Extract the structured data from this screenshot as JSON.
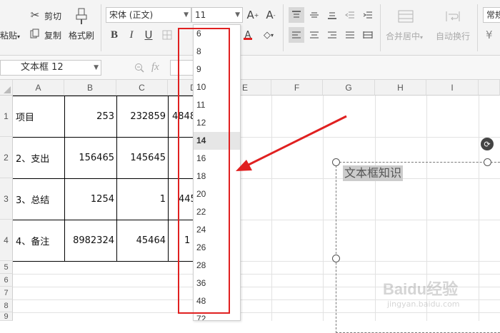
{
  "ribbon": {
    "cut": "剪切",
    "paste": "粘贴",
    "copy": "复制",
    "format_painter": "格式刷",
    "font_name": "宋体 (正文)",
    "font_size": "11",
    "bold": "B",
    "italic": "I",
    "underline": "U",
    "merge_center": "合并居中",
    "wrap_text": "自动换行",
    "number_format": "常规",
    "currency": "¥"
  },
  "formula_bar": {
    "name_box": "文本框 12",
    "fx": "fx"
  },
  "columns": [
    "A",
    "B",
    "C",
    "D",
    "E",
    "F",
    "G",
    "H",
    "I"
  ],
  "rows": [
    "1",
    "2",
    "3",
    "4",
    "5",
    "6",
    "7",
    "8",
    "9"
  ],
  "table": [
    {
      "a": "项目",
      "b": "253",
      "c": "232859",
      "d": "4848"
    },
    {
      "a": "2、支出",
      "b": "156465",
      "c": "145645",
      "d": ""
    },
    {
      "a": "3、总结",
      "b": "1254",
      "c": "1",
      "d": "445"
    },
    {
      "a": "4、备注",
      "b": "8982324",
      "c": "45464",
      "d": "1"
    }
  ],
  "font_size_dropdown": {
    "items": [
      "6",
      "8",
      "9",
      "10",
      "11",
      "12",
      "14",
      "16",
      "18",
      "20",
      "22",
      "24",
      "26",
      "28",
      "36",
      "48",
      "72"
    ],
    "highlighted": "14"
  },
  "textbox": {
    "text": "文本框知识"
  },
  "watermark": {
    "brand": "Baidu经验",
    "url": "jingyan.baidu.com"
  },
  "colors": {
    "annotation_red": "#e02020",
    "selection_gray": "#cccccc"
  }
}
